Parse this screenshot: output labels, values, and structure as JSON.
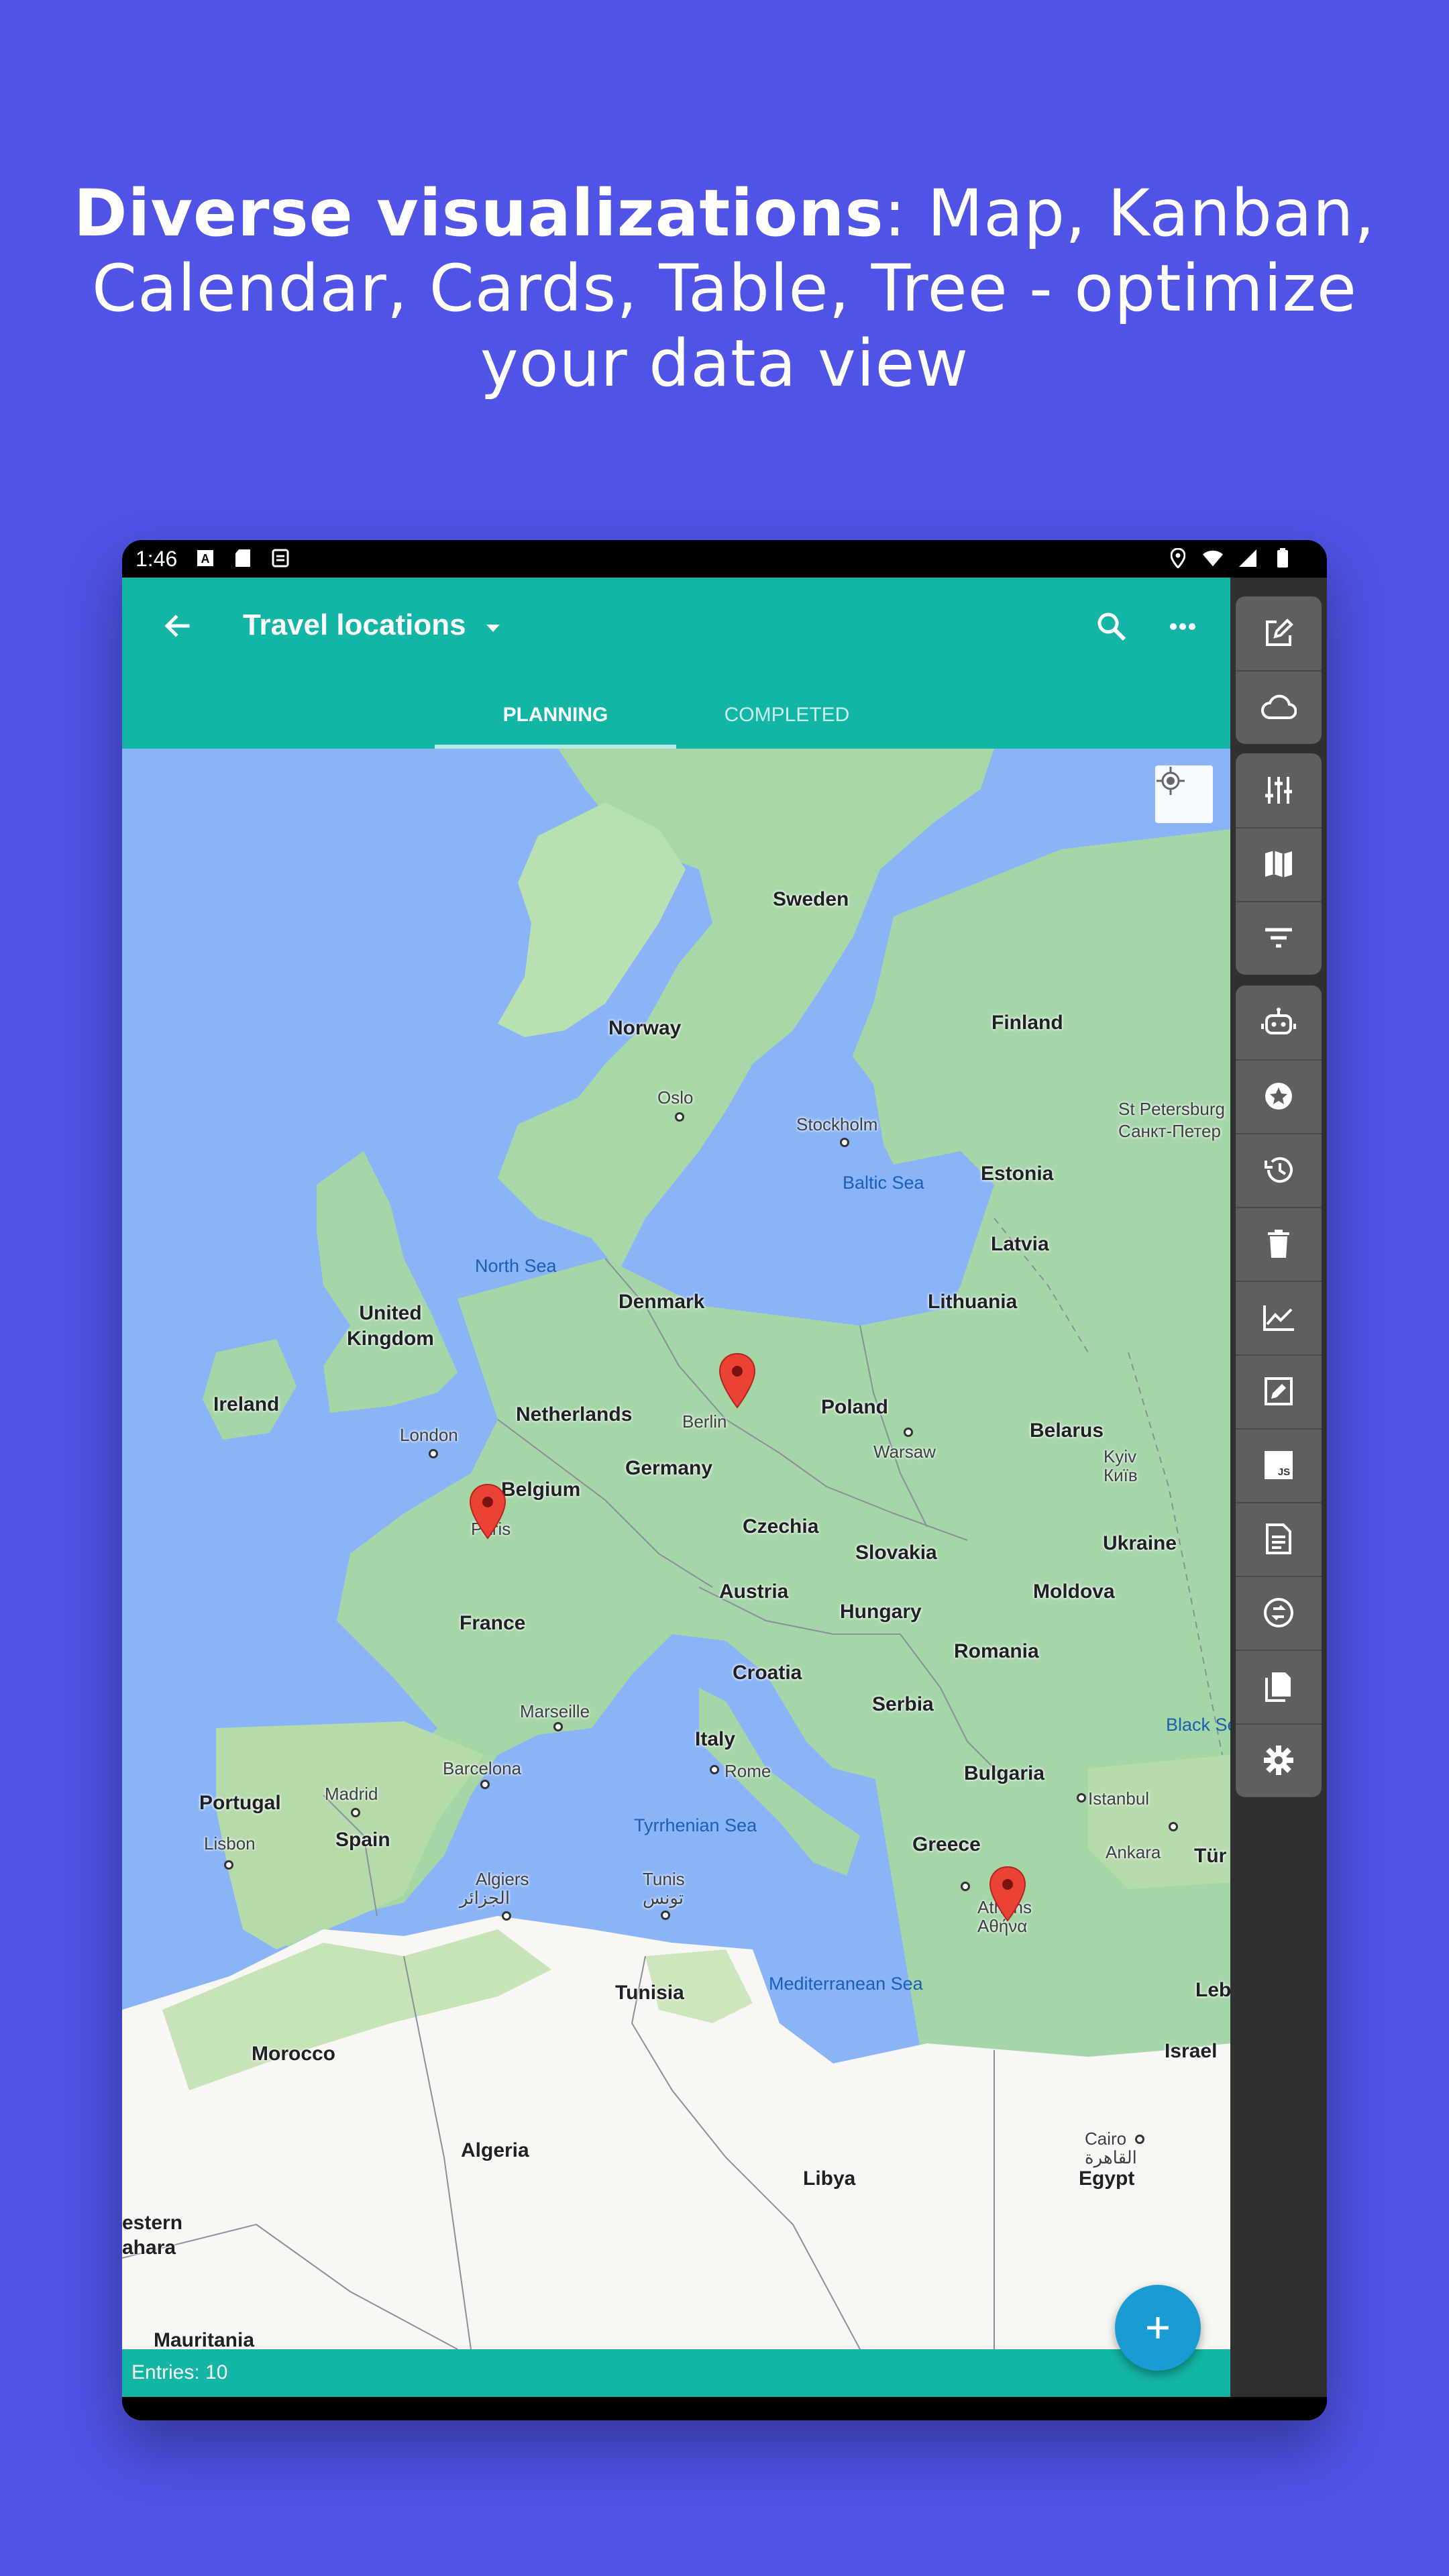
{
  "headline": {
    "bold": "Diverse visualizations",
    "rest": ": Map, Kanban, Calendar, Cards, Table, Tree - optimize your data view"
  },
  "status_bar": {
    "time": "1:46",
    "left_icons": [
      "a-notification-icon",
      "sd-card-icon",
      "sync-icon"
    ],
    "right_icons": [
      "location-icon",
      "wifi-icon",
      "signal-icon",
      "battery-icon"
    ]
  },
  "app_bar": {
    "title": "Travel locations",
    "back_icon": "arrow-back-icon",
    "dropdown_icon": "caret-down-icon",
    "search_icon": "search-icon",
    "more_icon": "more-horizontal-icon",
    "color": "#13b5a4"
  },
  "tabs": [
    {
      "label": "PLANNING",
      "selected": true
    },
    {
      "label": "COMPLETED",
      "selected": false
    }
  ],
  "map": {
    "my_location_icon": "my-location-icon",
    "countries": [
      "Sweden",
      "Norway",
      "Finland",
      "Estonia",
      "Latvia",
      "Lithuania",
      "Denmark",
      "United Kingdom",
      "Ireland",
      "Netherlands",
      "Belgium",
      "Germany",
      "Poland",
      "Belarus",
      "Czechia",
      "Slovakia",
      "Ukraine",
      "Austria",
      "Hungary",
      "Moldova",
      "France",
      "Croatia",
      "Romania",
      "Serbia",
      "Italy",
      "Bulgaria",
      "Portugal",
      "Spain",
      "Greece",
      "Tunisia",
      "Morocco",
      "Algeria",
      "Libya",
      "Egypt",
      "Israel",
      "Mauritania",
      "Tür",
      "Leb",
      "estern",
      "ahara"
    ],
    "cities": [
      "Oslo",
      "Stockholm",
      "St Petersburg",
      "Санкт-Петер",
      "London",
      "Berlin",
      "Warsaw",
      "Kyiv",
      "Київ",
      "Paris",
      "Marseille",
      "Barcelona",
      "Madrid",
      "Lisbon",
      "Rome",
      "Istanbul",
      "Ankara",
      "Athens",
      "Αθήνα",
      "Algiers",
      "الجزائر",
      "Tunis",
      "تونس",
      "Cairo",
      "القاهرة"
    ],
    "seas": [
      "North Sea",
      "Baltic Sea",
      "Tyrrhenian Sea",
      "Mediterranean Sea",
      "Black Se"
    ],
    "markers": [
      "Berlin",
      "Paris",
      "Athens"
    ]
  },
  "footer": {
    "entries": "Entries: 10"
  },
  "fab": {
    "icon": "plus-icon",
    "color": "#1a9bd4"
  },
  "side_panel": {
    "group1": [
      "edit-icon",
      "cloud-icon"
    ],
    "group2": [
      "tune-icon",
      "map-icon",
      "filter-icon"
    ],
    "group3": [
      "robot-icon",
      "star-icon",
      "history-icon",
      "trash-icon",
      "chart-icon",
      "edit-box-icon",
      "javascript-icon",
      "document-icon",
      "sync-circle-icon",
      "copy-icon",
      "settings-icon"
    ]
  }
}
